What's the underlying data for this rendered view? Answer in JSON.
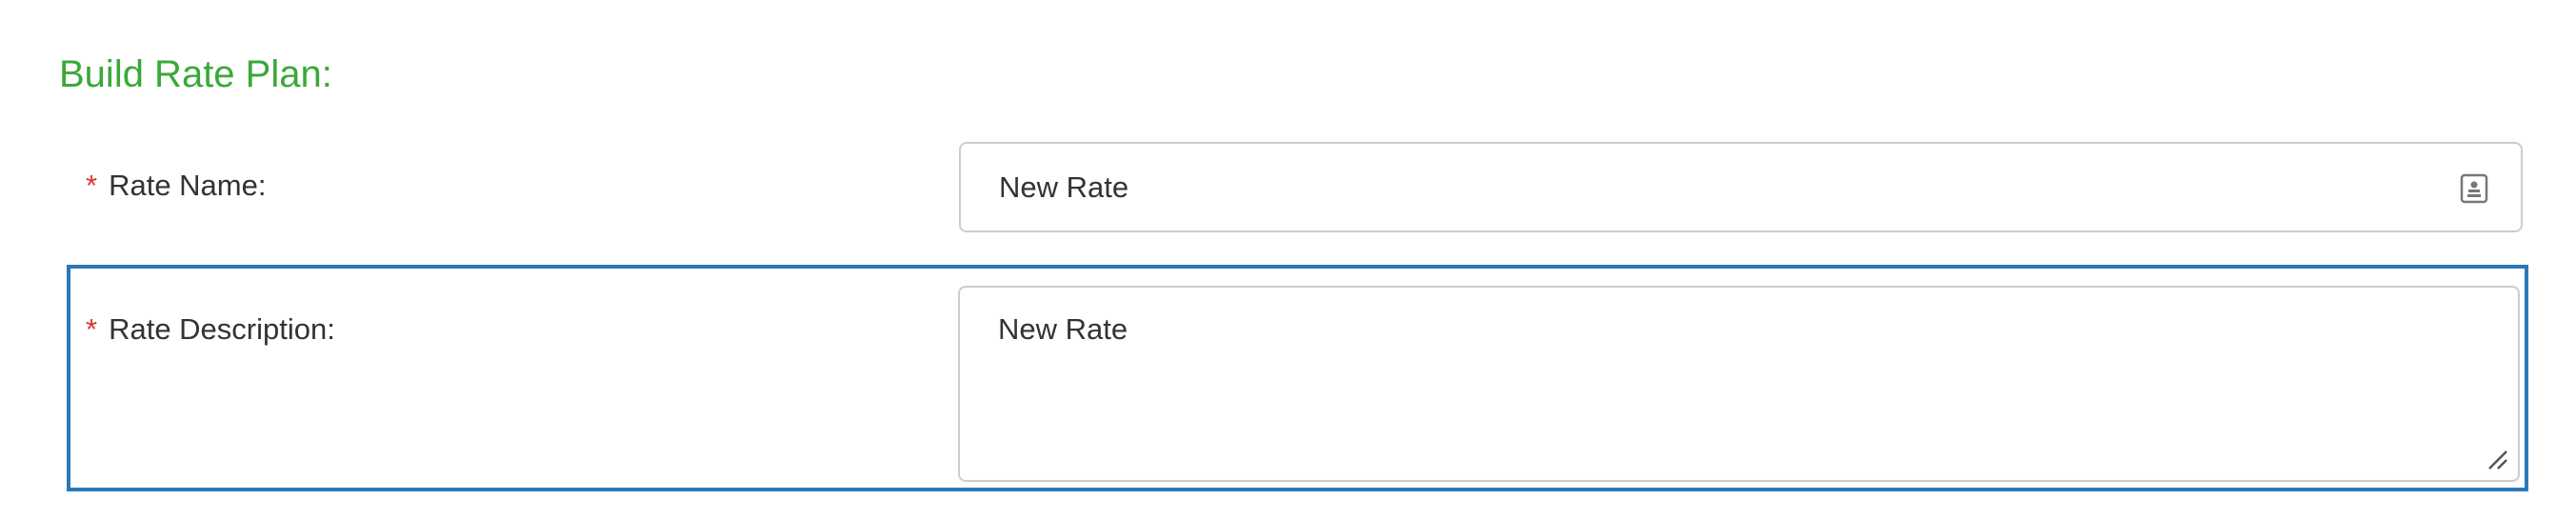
{
  "section": {
    "title": "Build Rate Plan:"
  },
  "fields": {
    "rate_name": {
      "required_marker": "*",
      "label": "Rate Name:",
      "value": "New Rate"
    },
    "rate_description": {
      "required_marker": "*",
      "label": "Rate Description:",
      "value": "New Rate"
    }
  },
  "colors": {
    "title": "#3aa83a",
    "required": "#d9342b",
    "focus_border": "#2a78b9",
    "input_border": "#cccccc",
    "text": "#333333"
  },
  "icons": {
    "rate_name_field": "contact-card-icon",
    "rate_description_field": "resize-handle-icon"
  }
}
